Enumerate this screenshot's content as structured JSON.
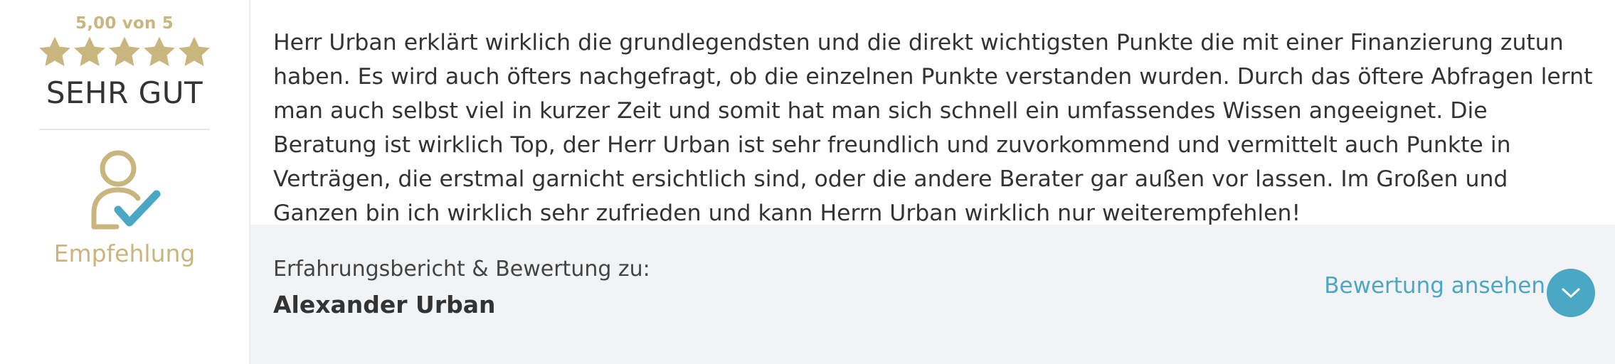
{
  "rating": {
    "score_text": "5,00 von 5",
    "stars": 5,
    "stars_max": 5,
    "word": "SEHR GUT"
  },
  "badge": {
    "icon": "user-check-icon",
    "label": "Empfehlung"
  },
  "review": {
    "text": "Herr Urban erklärt wirklich die grundlegendsten und die direkt wichtigsten Punkte die mit einer Finanzierung zutun haben. Es wird auch öfters nachgefragt, ob die einzelnen Punkte verstanden wurden. Durch das öftere Abfragen lernt man auch selbst viel in kurzer Zeit und somit hat man sich schnell ein umfassendes Wissen angeeignet. Die Beratung ist wirklich Top, der Herr Urban ist sehr freundlich und zuvorkommend und vermittelt auch Punkte in Verträgen, die erstmal garnicht ersichtlich sind, oder die andere Berater gar außen vor lassen. Im Großen und Ganzen bin ich wirklich sehr zufrieden und kann Herrn Urban wirklich nur weiterempfehlen!"
  },
  "footer": {
    "label": "Erfahrungsbericht & Bewertung zu:",
    "name": "Alexander Urban",
    "link_text": "Bewertung ansehen",
    "button_icon": "chevron-down-icon"
  },
  "colors": {
    "gold": "#c8b67e",
    "accent": "#4aa8c4",
    "text": "#333333",
    "footer_bg": "#f2f3f4"
  }
}
